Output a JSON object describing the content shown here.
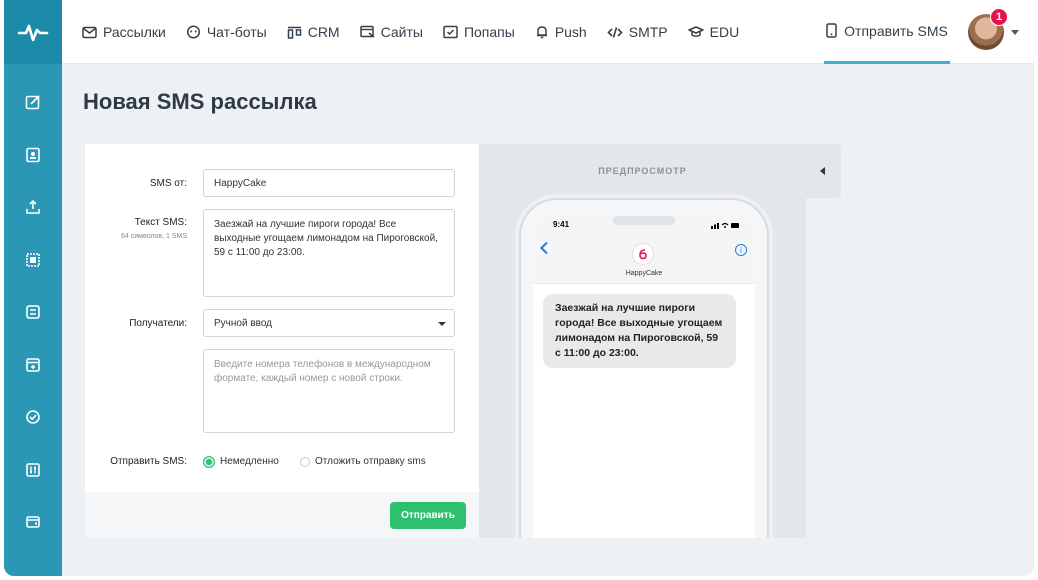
{
  "nav": {
    "items": [
      {
        "label": "Рассылки",
        "icon": "mail-icon"
      },
      {
        "label": "Чат-боты",
        "icon": "chatbot-icon"
      },
      {
        "label": "CRM",
        "icon": "crm-icon"
      },
      {
        "label": "Сайты",
        "icon": "site-icon"
      },
      {
        "label": "Попапы",
        "icon": "popup-icon"
      },
      {
        "label": "Push",
        "icon": "bell-icon"
      },
      {
        "label": "SMTP",
        "icon": "code-icon"
      },
      {
        "label": "EDU",
        "icon": "graduation-icon"
      }
    ],
    "active_action": "Отправить SMS",
    "notifications": "1"
  },
  "page": {
    "title": "Новая SMS рассылка"
  },
  "form": {
    "sender_label": "SMS от:",
    "sender_value": "HappyCake",
    "text_label": "Текст SMS:",
    "text_counter": "64 символов, 1 SMS",
    "text_value": "Заезжай на лучшие пироги города! Все выходные угощаем лимонадом на Пироговской, 59 с 11:00 до 23:00.",
    "recipients_label": "Получатели:",
    "recipients_value": "Ручной ввод",
    "phones_placeholder": "Введите номера телефонов в международном формате, каждый номер с новой строки.",
    "send_label": "Отправить SMS:",
    "option_now": "Немедленно",
    "option_later": "Отложить отправку sms",
    "selected_option": "now",
    "submit": "Отправить"
  },
  "preview": {
    "title": "ПРЕДПРОСМОТР",
    "time": "9:41",
    "contact": "HappyCake",
    "message": "Заезжай на лучшие пироги города! Все выходные угощаем лимонадом на Пироговской, 59 с 11:00 до 23:00."
  },
  "colors": {
    "sidebar": "#2a97b5",
    "accent": "#2fbf71",
    "tab_underline": "#3bb3cd",
    "badge": "#e8134b"
  }
}
